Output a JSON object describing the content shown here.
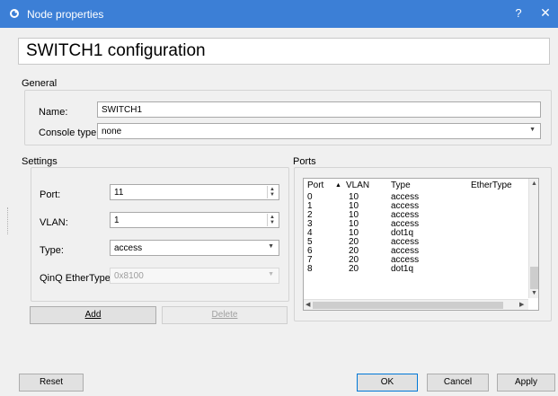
{
  "window": {
    "title": "Node properties",
    "help_label": "?",
    "close_label": "✕",
    "app_icon": "gns3-icon"
  },
  "header": {
    "title": "SWITCH1 configuration"
  },
  "general": {
    "label": "General",
    "name_label": "Name:",
    "name_value": "SWITCH1",
    "console_type_label": "Console type:",
    "console_type_value": "none"
  },
  "settings": {
    "label": "Settings",
    "port_label": "Port:",
    "port_value": "11",
    "vlan_label": "VLAN:",
    "vlan_value": "1",
    "type_label": "Type:",
    "type_value": "access",
    "qinq_label": "QinQ EtherType:",
    "qinq_value": "0x8100"
  },
  "buttons": {
    "add": "Add",
    "delete": "Delete",
    "reset": "Reset",
    "ok": "OK",
    "cancel": "Cancel",
    "apply": "Apply"
  },
  "ports": {
    "label": "Ports",
    "columns": [
      "Port",
      "VLAN",
      "Type",
      "EtherType"
    ],
    "sort_indicator": "▲",
    "rows": [
      {
        "port": "0",
        "vlan": "10",
        "type": "access",
        "ethertype": ""
      },
      {
        "port": "1",
        "vlan": "10",
        "type": "access",
        "ethertype": ""
      },
      {
        "port": "2",
        "vlan": "10",
        "type": "access",
        "ethertype": ""
      },
      {
        "port": "3",
        "vlan": "10",
        "type": "access",
        "ethertype": ""
      },
      {
        "port": "4",
        "vlan": "10",
        "type": "dot1q",
        "ethertype": ""
      },
      {
        "port": "5",
        "vlan": "20",
        "type": "access",
        "ethertype": ""
      },
      {
        "port": "6",
        "vlan": "20",
        "type": "access",
        "ethertype": ""
      },
      {
        "port": "7",
        "vlan": "20",
        "type": "access",
        "ethertype": ""
      },
      {
        "port": "8",
        "vlan": "20",
        "type": "dot1q",
        "ethertype": ""
      }
    ]
  },
  "colors": {
    "titlebar": "#3c7fd6",
    "dialog_bg": "#f0f0f0",
    "default_button_border": "#0078d7"
  }
}
